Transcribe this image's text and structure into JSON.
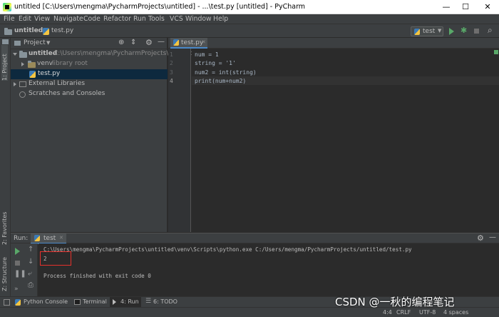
{
  "window": {
    "title": "untitled [C:\\Users\\mengma\\PycharmProjects\\untitled] - ...\\test.py [untitled] - PyCharm",
    "minimize": "—",
    "maximize": "☐",
    "close": "✕"
  },
  "menu": [
    "File",
    "Edit",
    "View",
    "Navigate",
    "Code",
    "Refactor",
    "Run",
    "Tools",
    "VCS",
    "Window",
    "Help"
  ],
  "breadcrumb": {
    "project": "untitled",
    "file": "test.py"
  },
  "run_config": "test",
  "sidebar_tabs": {
    "project": "1: Project",
    "favorites": "2: Favorites",
    "structure": "Z: Structure"
  },
  "project_panel": {
    "title": "Project",
    "tree": [
      {
        "label": "untitled",
        "extra": "C:\\Users\\mengma\\PycharmProjects\\untitled"
      },
      {
        "label": "venv",
        "extra": "library root"
      },
      {
        "label": "test.py",
        "extra": ""
      },
      {
        "label": "External Libraries",
        "extra": ""
      },
      {
        "label": "Scratches and Consoles",
        "extra": ""
      }
    ]
  },
  "editor": {
    "tab": "test.py",
    "line_numbers": [
      "1",
      "2",
      "3",
      "4"
    ],
    "lines": [
      "num = 1",
      "string = '1'",
      "num2 = int(string)",
      "print(num+num2)"
    ]
  },
  "run_panel": {
    "label": "Run:",
    "tab": "test",
    "console": [
      "C:\\Users\\mengma\\PycharmProjects\\untitled\\venv\\Scripts\\python.exe C:/Users/mengma/PycharmProjects/untitled/test.py",
      "2",
      "Process finished with exit code 0"
    ]
  },
  "bottom_tabs": {
    "python_console": "Python Console",
    "terminal": "Terminal",
    "run": "4: Run",
    "todo": "6: TODO"
  },
  "status": {
    "position": "4:4",
    "line_sep": "CRLF",
    "encoding": "UTF-8",
    "indent": "4 spaces"
  },
  "watermark": "CSDN @一秋的编程笔记",
  "colors": {
    "accent": "#4a88c7",
    "selection": "#0d293e",
    "highlight_box": "#e6312c",
    "run_green": "#59a869"
  }
}
